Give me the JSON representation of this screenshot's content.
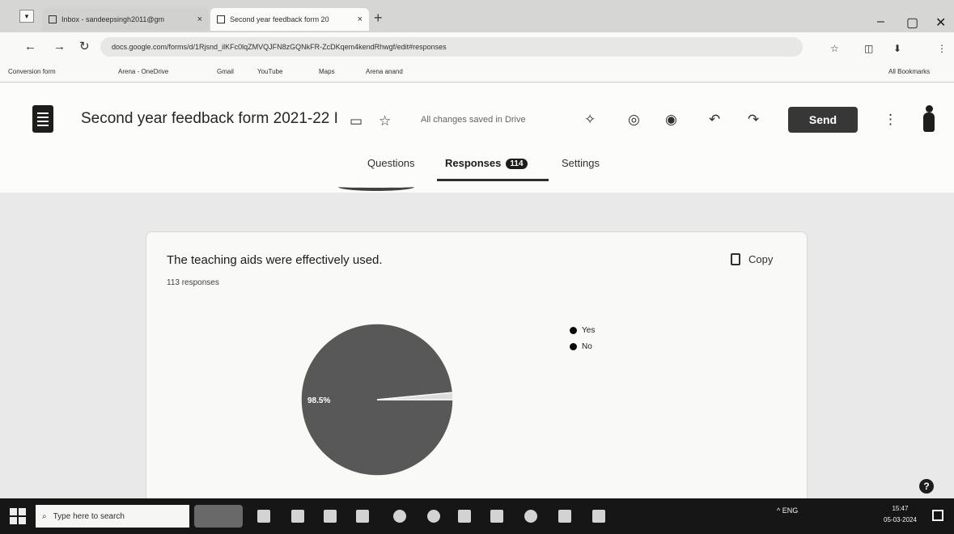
{
  "browser": {
    "tabs": [
      {
        "title": "Inbox - sandeepsingh2011@gm",
        "active": false
      },
      {
        "title": "Second year feedback form 20",
        "active": true
      }
    ],
    "new_tab": "+",
    "window_controls": {
      "minimize": "–",
      "maximize": "▢",
      "close": "✕"
    },
    "url": "docs.google.com/forms/d/1Rjsnd_ilKFc0lqZMVQJFN8zGQNkFR-ZcDKqem4kendRhwgf/edit#responses",
    "bookmarks": [
      "Conversion form",
      "Arena - OneDrive",
      "Gmail",
      "YouTube",
      "Maps",
      "Arena anand"
    ],
    "all_bookmarks": "All Bookmarks"
  },
  "form": {
    "title": "Second year feedback form 2021-22 I",
    "saved_status": "All changes saved in Drive",
    "send_label": "Send",
    "tabs": {
      "questions": "Questions",
      "responses": "Responses",
      "responses_count": "114",
      "settings": "Settings"
    }
  },
  "card": {
    "question": "The teaching aids were effectively used.",
    "responses": "113 responses",
    "copy_label": "Copy",
    "slice_label": "98.5%"
  },
  "chart_data": {
    "type": "pie",
    "title": "",
    "categories": [
      "Yes",
      "No"
    ],
    "values": [
      98.5,
      1.5
    ],
    "colors": [
      "#5a5a5a",
      "#d8d8d8"
    ],
    "legend_position": "right"
  },
  "taskbar": {
    "search_placeholder": "Type here to search",
    "tray_text": "^  ENG",
    "time": "15:47",
    "date": "05-03-2024"
  },
  "help_label": "?"
}
